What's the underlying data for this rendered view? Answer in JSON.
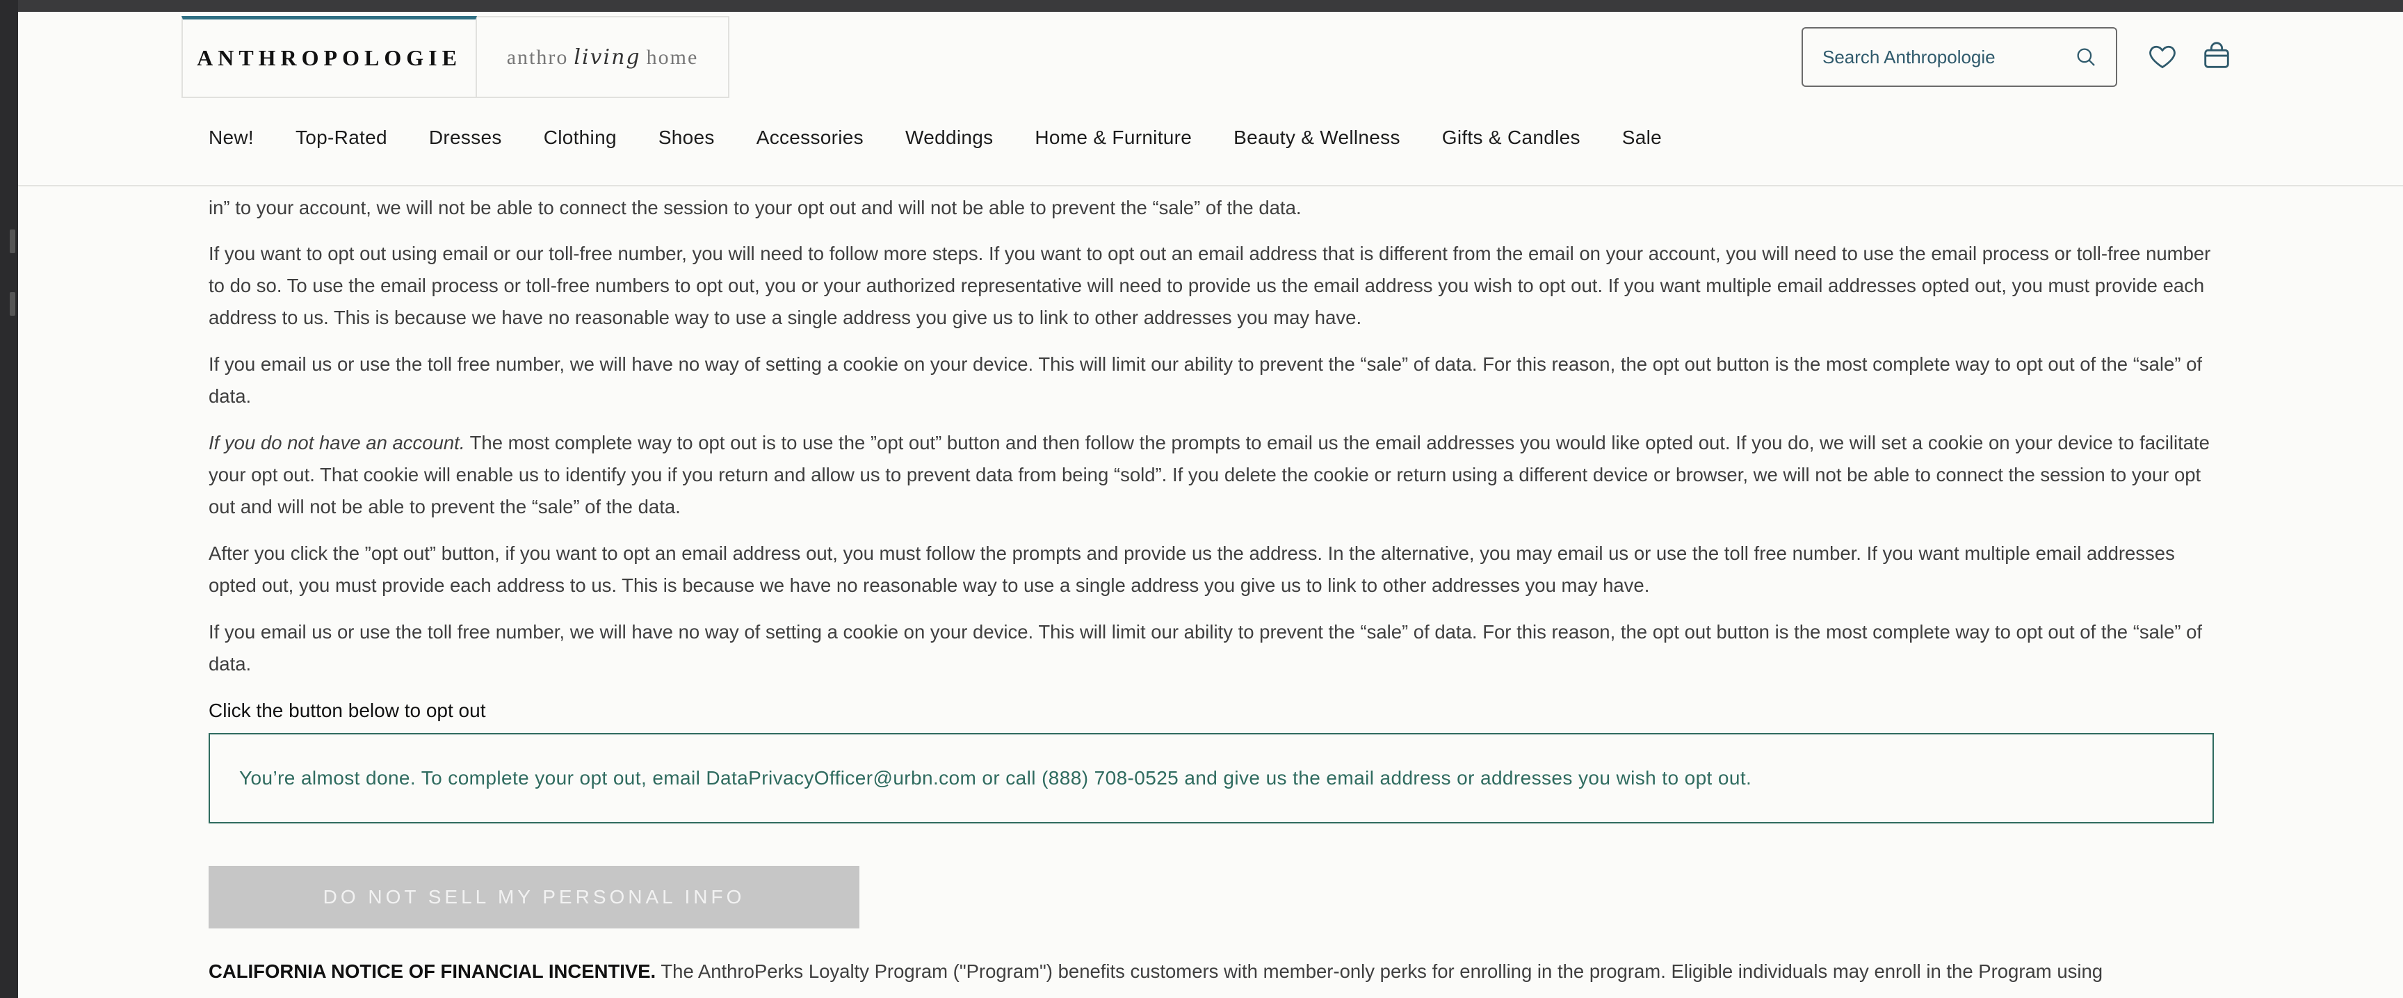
{
  "header": {
    "brand_main": "ANTHROPOLOGIE",
    "brand_sub_left": "anthro",
    "brand_sub_script": "living",
    "brand_sub_right": "home",
    "search_placeholder": "Search Anthropologie",
    "icons": {
      "search": "search-icon",
      "wishlist": "heart-icon",
      "cart": "bag-icon"
    },
    "accent_color": "#2f6f83"
  },
  "nav": {
    "items": [
      "New!",
      "Top-Rated",
      "Dresses",
      "Clothing",
      "Shoes",
      "Accessories",
      "Weddings",
      "Home & Furniture",
      "Beauty & Wellness",
      "Gifts & Candles",
      "Sale"
    ]
  },
  "content": {
    "p0_partial": "in” to your account, we will not be able to connect the session to your opt out and will not be able to prevent the “sale” of the data.",
    "p1": "If you want to opt out using email or our toll-free number, you will need to follow more steps. If you want to opt out an email address that is different from the email on your account, you will need to use the email process or toll-free number to do so. To use the email process or toll-free numbers to opt out, you or your authorized representative will need to provide us the email address you wish to opt out. If you want multiple email addresses opted out, you must provide each address to us. This is because we have no reasonable way to use a single address you give us to link to other addresses you may have.",
    "p2": "If you email us or use the toll free number, we will have no way of setting a cookie on your device. This will limit our ability to prevent the “sale” of data. For this reason, the opt out button is the most complete way to opt out of the “sale” of data.",
    "p3_lead": "If you do not have an account.",
    "p3_body": " The most complete way to opt out is to use the ”opt out” button and then follow the prompts to email us the email addresses you would like opted out. If you do, we will set a cookie on your device to facilitate your opt out. That cookie will enable us to identify you if you return and allow us to prevent data from being “sold”. If you delete the cookie or return using a different device or browser, we will not be able to connect the session to your opt out and will not be able to prevent the “sale” of the data.",
    "p4": "After you click the ”opt out” button, if you want to opt an email address out, you must follow the prompts and provide us the address. In the alternative, you may email us or use the toll free number. If you want multiple email addresses opted out, you must provide each address to us. This is because we have no reasonable way to use a single address you give us to link to other addresses you may have.",
    "p5": "If you email us or use the toll free number, we will have no way of setting a cookie on your device. This will limit our ability to prevent the “sale” of data. For this reason, the opt out button is the most complete way to opt out of the “sale” of data.",
    "cta_heading": "Click the button below to opt out",
    "notice": "You’re almost done. To complete your opt out, email DataPrivacyOfficer@urbn.com or call (888) 708-0525 and give us the email address or addresses you wish to opt out.",
    "optout_button": "DO NOT SELL MY PERSONAL INFO",
    "financial_heading": "CALIFORNIA NOTICE OF FINANCIAL INCENTIVE.",
    "financial_body": " The AnthroPerks Loyalty Program (\"Program\") benefits customers with member-only perks for enrolling in the program. Eligible individuals may enroll in the Program using",
    "notice_color": "#2f6b5f"
  }
}
